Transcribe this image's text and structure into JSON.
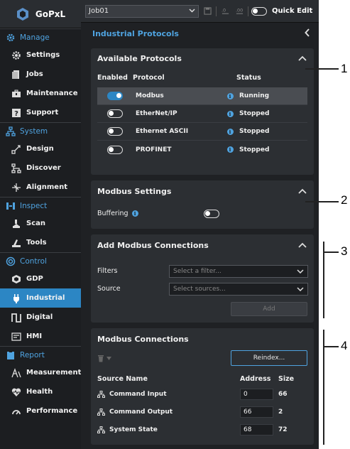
{
  "app": {
    "title": "GoPxL"
  },
  "sidebar": {
    "sections": [
      {
        "label": "Manage",
        "icon": "manage-gear-icon",
        "items": [
          {
            "label": "Settings",
            "icon": "settings-gear-icon"
          },
          {
            "label": "Jobs",
            "icon": "jobs-document-icon"
          },
          {
            "label": "Maintenance",
            "icon": "maintenance-toolbox-icon"
          },
          {
            "label": "Support",
            "icon": "support-help-icon"
          }
        ]
      },
      {
        "label": "System",
        "icon": "system-network-icon",
        "items": [
          {
            "label": "Design",
            "icon": "design-icon"
          },
          {
            "label": "Discover",
            "icon": "discover-network-icon"
          },
          {
            "label": "Alignment",
            "icon": "alignment-icon"
          }
        ]
      },
      {
        "label": "Inspect",
        "icon": "inspect-icon",
        "items": [
          {
            "label": "Scan",
            "icon": "scan-icon"
          },
          {
            "label": "Tools",
            "icon": "tools-icon"
          }
        ]
      },
      {
        "label": "Control",
        "icon": "control-icon",
        "items": [
          {
            "label": "GDP",
            "icon": "gdp-icon"
          },
          {
            "label": "Industrial",
            "icon": "industrial-plug-icon",
            "active": true
          },
          {
            "label": "Digital",
            "icon": "digital-pulse-icon"
          },
          {
            "label": "HMI",
            "icon": "hmi-screen-icon"
          }
        ]
      },
      {
        "label": "Report",
        "icon": "report-clipboard-icon",
        "items": [
          {
            "label": "Measurements",
            "icon": "measurements-icon"
          },
          {
            "label": "Health",
            "icon": "health-heart-icon"
          },
          {
            "label": "Performance",
            "icon": "performance-gauge-icon"
          }
        ]
      }
    ]
  },
  "toolbar": {
    "job": "Job01",
    "quick_edit_label": "Quick Edit",
    "quick_edit_on": false
  },
  "panel": {
    "title": "Industrial Protocols"
  },
  "available_protocols": {
    "title": "Available Protocols",
    "headers": {
      "enabled": "Enabled",
      "protocol": "Protocol",
      "status": "Status"
    },
    "rows": [
      {
        "enabled": true,
        "protocol": "Modbus",
        "status": "Running",
        "selected": true
      },
      {
        "enabled": false,
        "protocol": "EtherNet/IP",
        "status": "Stopped"
      },
      {
        "enabled": false,
        "protocol": "Ethernet ASCII",
        "status": "Stopped"
      },
      {
        "enabled": false,
        "protocol": "PROFINET",
        "status": "Stopped"
      }
    ]
  },
  "modbus_settings": {
    "title": "Modbus Settings",
    "buffering_label": "Buffering",
    "buffering_on": false
  },
  "add_connections": {
    "title": "Add Modbus Connections",
    "filters_label": "Filters",
    "filters_placeholder": "Select a filter...",
    "source_label": "Source",
    "source_placeholder": "Select sources...",
    "add_label": "Add"
  },
  "modbus_connections": {
    "title": "Modbus Connections",
    "reindex_label": "Reindex...",
    "headers": {
      "name": "Source Name",
      "address": "Address",
      "size": "Size"
    },
    "rows": [
      {
        "name": "Command Input",
        "address": "0",
        "size": "66"
      },
      {
        "name": "Command Output",
        "address": "66",
        "size": "2"
      },
      {
        "name": "System State",
        "address": "68",
        "size": "72"
      }
    ]
  },
  "callouts": [
    "1",
    "2",
    "3",
    "4"
  ]
}
